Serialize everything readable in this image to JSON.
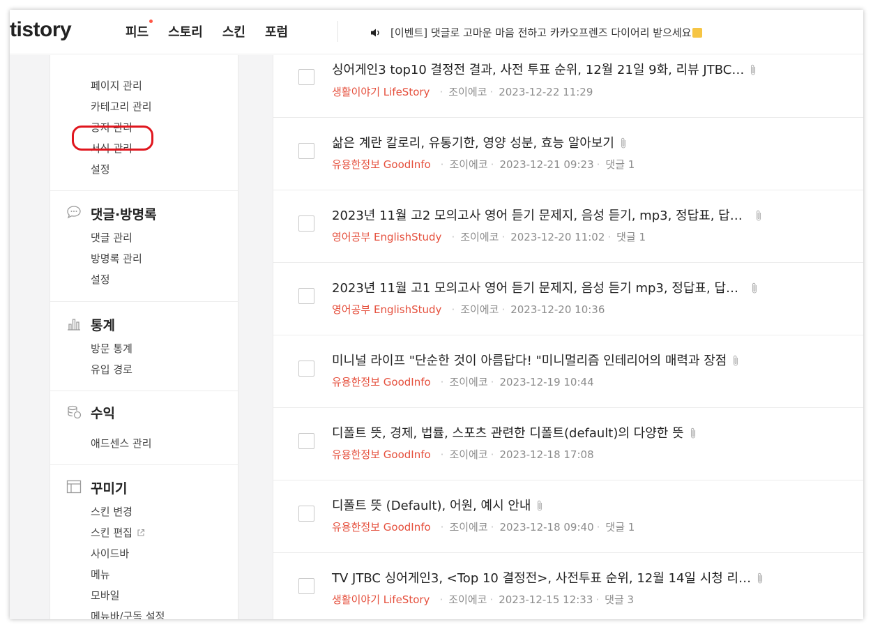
{
  "header": {
    "logo": "tistory",
    "nav": [
      {
        "label": "피드",
        "has_dot": true
      },
      {
        "label": "스토리",
        "has_dot": false
      },
      {
        "label": "스킨",
        "has_dot": false
      },
      {
        "label": "포럼",
        "has_dot": false
      }
    ],
    "notice": "[이벤트] 댓글로 고마운 마음 전하고 카카오프렌즈 다이어리 받으세요",
    "icons": {
      "speaker": "speaker-icon",
      "note": "memo-icon"
    }
  },
  "sidebar": {
    "manage_links": [
      "페이지 관리",
      "카테고리 관리",
      "공지 관리",
      "서식 관리",
      "설정"
    ],
    "highlighted_item": "서식 관리",
    "comments": {
      "title": "댓글·방명록",
      "icon": "comment-bubble-icon",
      "links": [
        "댓글 관리",
        "방명록 관리",
        "설정"
      ]
    },
    "stats": {
      "title": "통계",
      "icon": "bar-chart-icon",
      "links": [
        "방문 통계",
        "유입 경로"
      ]
    },
    "revenue": {
      "title": "수익",
      "icon": "coins-icon",
      "links": [
        "애드센스 관리"
      ]
    },
    "decorate": {
      "title": "꾸미기",
      "icon": "layout-icon",
      "links": [
        "스킨 변경",
        "스킨 편집",
        "사이드바",
        "메뉴",
        "모바일",
        "메뉴바/구독 설정"
      ],
      "external_link": "스킨 편집"
    }
  },
  "posts": [
    {
      "title": "싱어게인3 top10 결정전 결과, 사전 투표 순위, 12월 21일 9화, 리뷰 JTBC…",
      "category": "생활이야기 LifeStory",
      "author": "조이에코",
      "date": "2023-12-22 11:29",
      "comments": ""
    },
    {
      "title": "삶은 계란 칼로리, 유통기한, 영양 성분, 효능 알아보기",
      "category": "유용한정보 GoodInfo",
      "author": "조이에코",
      "date": "2023-12-21 09:23",
      "comments": "댓글 1"
    },
    {
      "title": "2023년 11월 고2 모의고사 영어 듣기 문제지, 음성 듣기, mp3, 정답표, 답…",
      "category": "영어공부 EnglishStudy",
      "author": "조이에코",
      "date": "2023-12-20 11:02",
      "comments": "댓글 1"
    },
    {
      "title": "2023년 11월 고1 모의고사 영어 듣기 문제지, 음성 듣기 mp3, 정답표, 답…",
      "category": "영어공부 EnglishStudy",
      "author": "조이에코",
      "date": "2023-12-20 10:36",
      "comments": ""
    },
    {
      "title": "미니널 라이프 \"단순한 것이 아름답다! \"미니멀리즘 인테리어의 매력과 장점",
      "category": "유용한정보 GoodInfo",
      "author": "조이에코",
      "date": "2023-12-19 10:44",
      "comments": ""
    },
    {
      "title": "디폴트 뜻, 경제, 법률, 스포츠 관련한 디폴트(default)의 다양한 뜻",
      "category": "유용한정보 GoodInfo",
      "author": "조이에코",
      "date": "2023-12-18 17:08",
      "comments": ""
    },
    {
      "title": "디폴트 뜻 (Default), 어원, 예시 안내",
      "category": "유용한정보 GoodInfo",
      "author": "조이에코",
      "date": "2023-12-18 09:40",
      "comments": "댓글 1"
    },
    {
      "title": "TV JTBC 싱어게인3, <Top 10 결정전>, 사전투표 순위, 12월 14일 시청 리…",
      "category": "생활이야기 LifeStory",
      "author": "조이에코",
      "date": "2023-12-15 12:33",
      "comments": "댓글 3"
    }
  ],
  "colors": {
    "category": "#e54f3c",
    "highlight": "#e0161e",
    "nav_dot": "#ff5544",
    "gutter": "#f4f4f5"
  }
}
